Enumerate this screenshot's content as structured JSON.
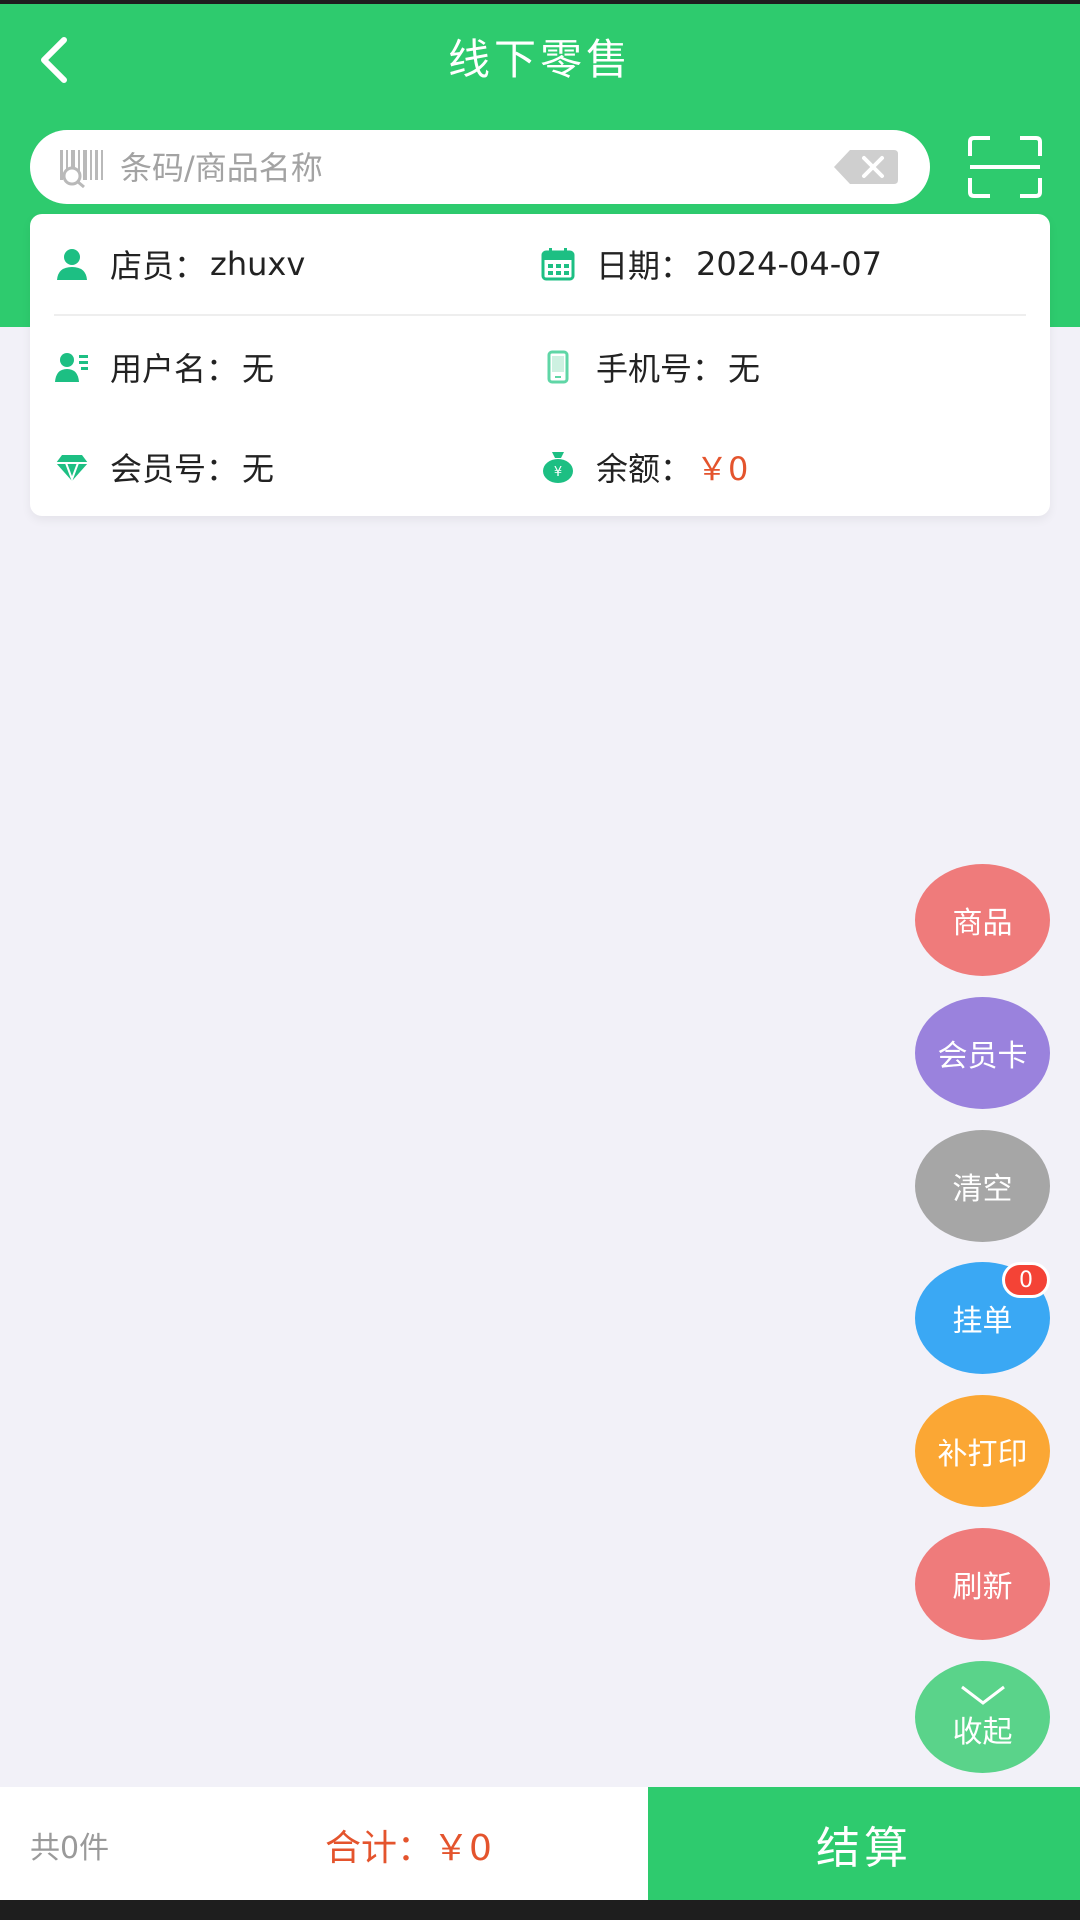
{
  "header": {
    "title": "线下零售"
  },
  "search": {
    "placeholder": "条码/商品名称"
  },
  "info": {
    "clerk_label": "店员：",
    "clerk_value": "zhuxv",
    "date_label": "日期：",
    "date_value": "2024-04-07",
    "username_label": "用户名：",
    "username_value": "无",
    "phone_label": "手机号：",
    "phone_value": "无",
    "member_label": "会员号：",
    "member_value": "无",
    "balance_label": "余额：",
    "balance_value": "￥0"
  },
  "fab": {
    "products": "商品",
    "member_card": "会员卡",
    "clear": "清空",
    "hold_order": "挂单",
    "hold_order_badge": "0",
    "reprint": "补打印",
    "refresh": "刷新",
    "collapse": "收起"
  },
  "footer": {
    "count": "共0件",
    "total_label": "合计：",
    "total_value": "￥0",
    "checkout": "结算"
  },
  "colors": {
    "primary_green": "#2ecb6e",
    "accent_red": "#e4542d",
    "fab_red": "#ef7b7b",
    "fab_purple": "#9a82dd",
    "fab_gray": "#a6a6a6",
    "fab_blue": "#3aa8f4",
    "fab_orange": "#fba734",
    "fab_green": "#5ad38a"
  },
  "icons": {
    "back": "chevron-left-icon",
    "barcode": "barcode-search-icon",
    "clear": "backspace-clear-icon",
    "scan": "scan-frame-icon",
    "clerk": "person-icon",
    "date": "calendar-icon",
    "username": "id-card-icon",
    "phone": "phone-icon",
    "member": "diamond-icon",
    "balance": "money-bag-icon",
    "collapse": "chevron-down-icon"
  }
}
